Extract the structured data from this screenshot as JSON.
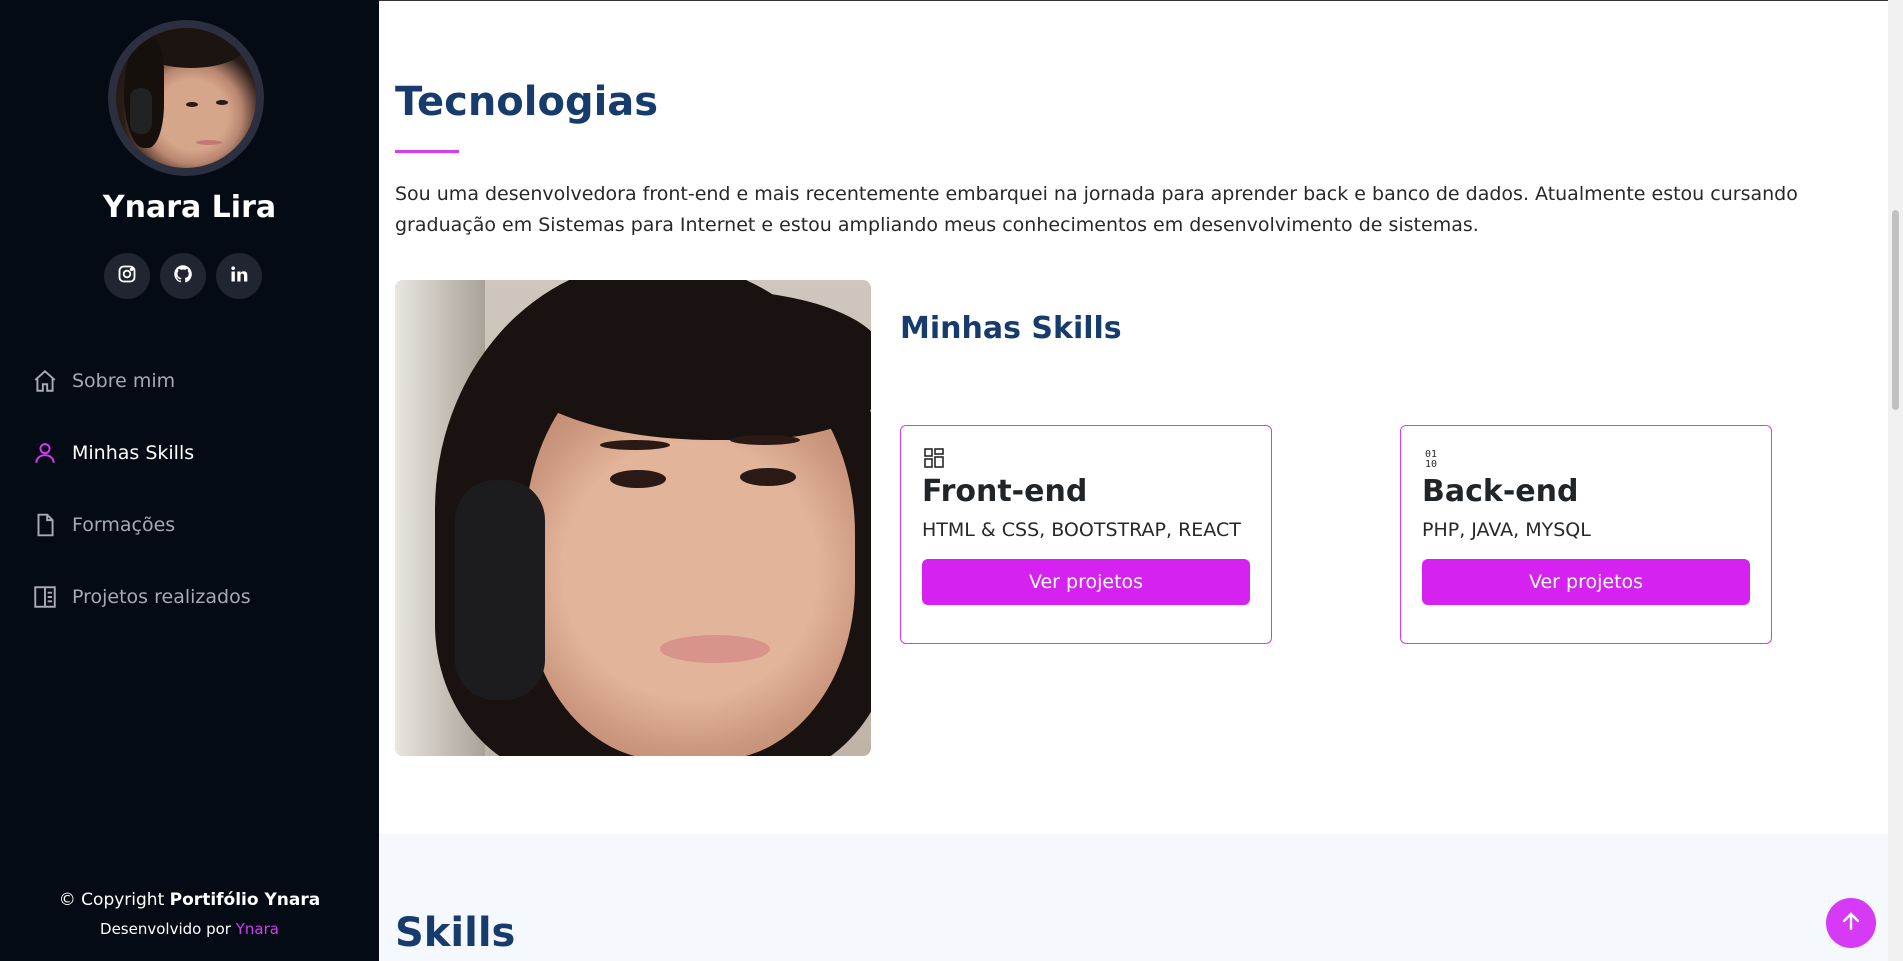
{
  "profile": {
    "name": "Ynara Lira",
    "socials": [
      "instagram-icon",
      "github-icon",
      "linkedin-icon"
    ]
  },
  "nav": {
    "items": [
      {
        "label": "Sobre mim",
        "icon": "home-icon",
        "active": false
      },
      {
        "label": "Minhas Skills",
        "icon": "user-icon",
        "active": true
      },
      {
        "label": "Formações",
        "icon": "file-icon",
        "active": false
      },
      {
        "label": "Projetos realizados",
        "icon": "layout-icon",
        "active": false
      }
    ]
  },
  "footer": {
    "copyright_prefix": "© Copyright",
    "copyright_brand": "Portifólio Ynara",
    "dev_prefix": "Desenvolvido por",
    "dev_name": "Ynara"
  },
  "main": {
    "title": "Tecnologias",
    "intro": "Sou uma desenvolvedora front-end e mais recentemente embarquei na jornada para aprender back e banco de dados. Atualmente estou cursando graduação em Sistemas para Internet e estou ampliando meus conhecimentos em desenvolvimento de sistemas.",
    "skills_title": "Minhas Skills",
    "cards": [
      {
        "icon": "grid-icon",
        "title": "Front-end",
        "text": "HTML & CSS, BOOTSTRAP, REACT",
        "button": "Ver projetos"
      },
      {
        "icon": "binary-icon",
        "title": "Back-end",
        "text": "PHP, JAVA, MYSQL",
        "button": "Ver projetos"
      }
    ],
    "next_section_title": "Skills"
  },
  "colors": {
    "sidebar_bg": "#040b14",
    "accent": "#d63af4",
    "heading": "#173b6c",
    "band_bg": "#f5f8fd"
  }
}
